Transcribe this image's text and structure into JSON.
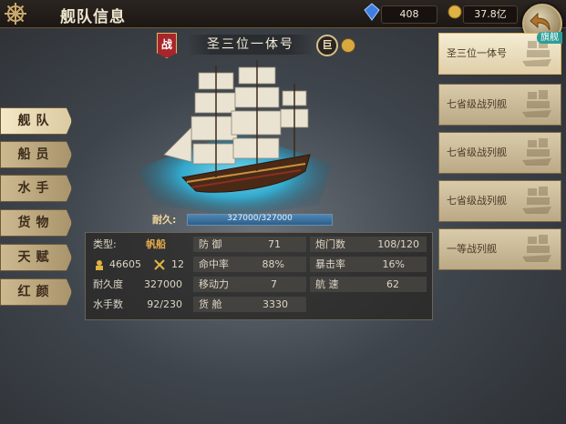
{
  "header": {
    "title": "舰队信息",
    "gems": "408",
    "gold": "37.8亿"
  },
  "ship": {
    "battle_badge": "战",
    "name": "圣三位一体号",
    "size_badge": "巨",
    "durability_label": "耐久:",
    "durability_text": "327000/327000",
    "durability_fraction": 1.0
  },
  "tabs": [
    {
      "label": "舰队",
      "active": true
    },
    {
      "label": "船员",
      "active": false
    },
    {
      "label": "水手",
      "active": false
    },
    {
      "label": "货物",
      "active": false
    },
    {
      "label": "天赋",
      "active": false
    },
    {
      "label": "红颜",
      "active": false
    }
  ],
  "stats": {
    "type_label": "类型:",
    "type_value": "帆船",
    "troops_value": "46605",
    "swords_value": "12",
    "durability_label": "耐久度",
    "durability_value": "327000",
    "sailors_label": "水手数",
    "sailors_value": "92/230",
    "defense_label": "防 御",
    "defense_value": "71",
    "accuracy_label": "命中率",
    "accuracy_value": "88%",
    "mobility_label": "移动力",
    "mobility_value": "7",
    "cargo_label": "货 舱",
    "cargo_value": "3330",
    "guns_label": "炮门数",
    "guns_value": "108/120",
    "crit_label": "暴击率",
    "crit_value": "16%",
    "speed_label": "航 速",
    "speed_value": "62"
  },
  "fleet": [
    {
      "name": "圣三位一体号",
      "selected": true,
      "tag": "旗舰"
    },
    {
      "name": "七省级战列舰",
      "selected": false
    },
    {
      "name": "七省级战列舰",
      "selected": false
    },
    {
      "name": "七省级战列舰",
      "selected": false
    },
    {
      "name": "一等战列舰",
      "selected": false
    }
  ],
  "colors": {
    "accent_gold": "#e3a84c",
    "tab_active": "#f3e8c7",
    "flag_tag": "#2e9e97"
  }
}
